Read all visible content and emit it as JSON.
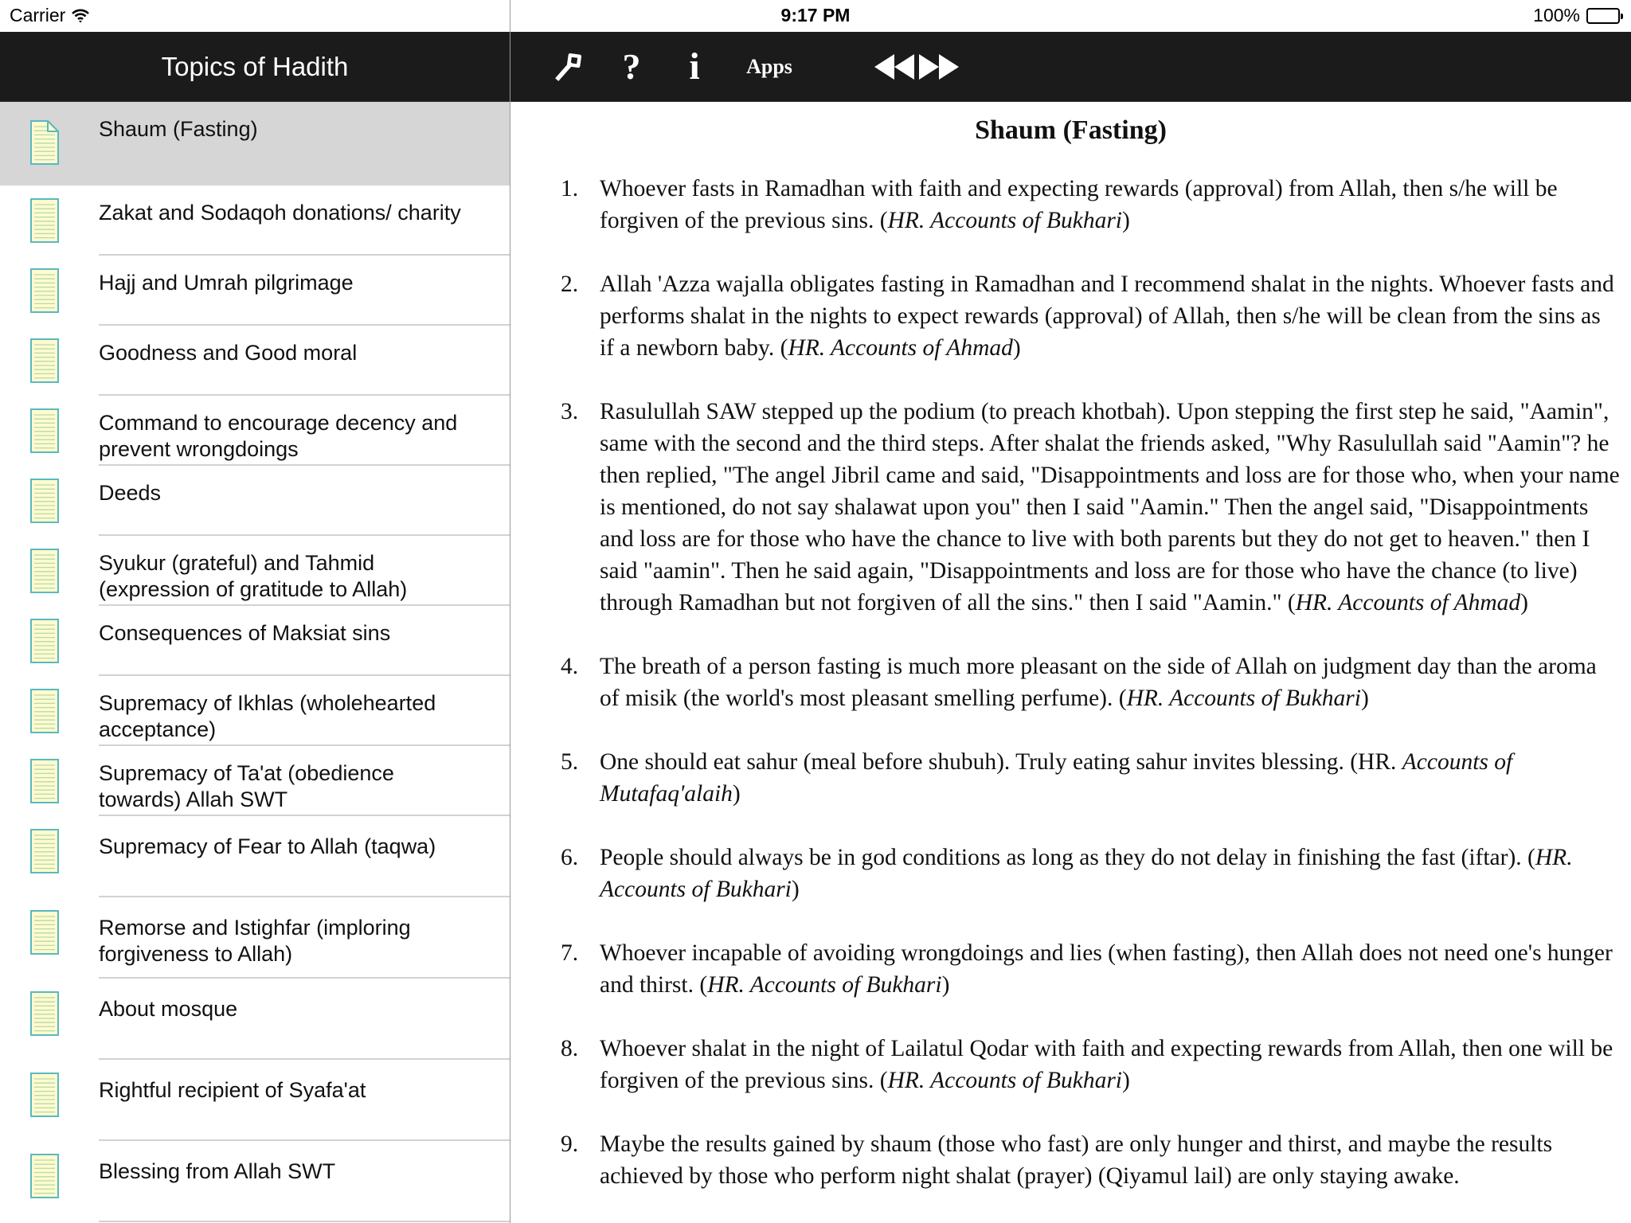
{
  "status_bar": {
    "carrier": "Carrier",
    "time": "9:17 PM",
    "battery": "100%",
    "wifi_icon": "wifi-icon",
    "battery_icon": "battery-icon"
  },
  "sidebar": {
    "title": "Topics of Hadith",
    "selected_index": 0,
    "items": [
      {
        "label": "Shaum (Fasting)"
      },
      {
        "label": "Zakat and Sodaqoh donations/ charity"
      },
      {
        "label": "Hajj and Umrah pilgrimage"
      },
      {
        "label": "Goodness and Good moral"
      },
      {
        "label": "Command to encourage decency and prevent wrongdoings"
      },
      {
        "label": "Deeds"
      },
      {
        "label": "Syukur (grateful) and Tahmid (expression of gratitude to Allah)"
      },
      {
        "label": "Consequences of Maksiat sins"
      },
      {
        "label": "Supremacy of Ikhlas (wholehearted acceptance)"
      },
      {
        "label": "Supremacy of Ta'at (obedience towards) Allah SWT"
      },
      {
        "label": "Supremacy of Fear to Allah (taqwa)"
      },
      {
        "label": "Remorse and Istighfar (imploring forgiveness to Allah)"
      },
      {
        "label": "About mosque"
      },
      {
        "label": "Rightful recipient of Syafa'at"
      },
      {
        "label": "Blessing from Allah SWT"
      }
    ]
  },
  "toolbar": {
    "settings_icon": "wrench-icon",
    "help_label": "?",
    "info_label": "i",
    "apps_label": "Apps",
    "prev_icon": "rewind-icon",
    "next_icon": "fast-forward-icon"
  },
  "content": {
    "title": "Shaum (Fasting)",
    "hadiths": [
      {
        "num": "1.",
        "text": "Whoever fasts in Ramadhan with faith and expecting rewards (approval) from Allah, then s/he will be forgiven of the previous sins. (",
        "source": "HR. Accounts of Bukhari",
        "end": ")"
      },
      {
        "num": "2.",
        "text": "Allah 'Azza wajalla obligates fasting in Ramadhan and I recommend shalat in the nights. Whoever fasts and performs shalat in the nights to expect rewards (approval) of Allah, then s/he will be clean from the sins as if a newborn baby. (",
        "source": "HR. Accounts of Ahmad",
        "end": ")"
      },
      {
        "num": "3.",
        "text": "Rasulullah SAW stepped up the podium (to preach khotbah). Upon stepping the first step he said, \"Aamin\", same with the second and the third steps. After shalat the friends asked, \"Why Rasulullah said \"Aamin\"? he then replied, \"The angel Jibril came and said, \"Disappointments and loss are for those who, when your name is mentioned, do not say shalawat upon you\" then I said \"Aamin.\" Then the angel said, \"Disappointments and loss are for those who have the chance to live with both parents but they do not get to heaven.\" then I said \"aamin\". Then he said again, \"Disappointments and loss are for those who have the chance (to live) through Ramadhan but not forgiven of all the sins.\" then I said \"Aamin.\" (",
        "source": "HR. Accounts of Ahmad",
        "end": ")"
      },
      {
        "num": "4.",
        "text": "The breath of a person fasting is much more pleasant on the side of Allah on judgment day than the aroma of misik (the world's most pleasant smelling perfume). (",
        "source": "HR. Accounts of Bukhari",
        "end": ")"
      },
      {
        "num": "5.",
        "text": "One should eat sahur (meal before shubuh). Truly eating sahur invites blessing. (HR. ",
        "source": "Accounts of Mutafaq'alaih",
        "end": ")"
      },
      {
        "num": "6.",
        "text": "People should always be in god conditions as long as they do not delay in finishing the fast (iftar). (",
        "source": "HR. Accounts of Bukhari",
        "end": ")"
      },
      {
        "num": "7.",
        "text": "Whoever incapable of avoiding wrongdoings and lies (when fasting), then Allah does not need one's hunger and thirst. (",
        "source": "HR. Accounts of Bukhari",
        "end": ")"
      },
      {
        "num": "8.",
        "text": "Whoever shalat in the night of Lailatul Qodar with faith and expecting rewards from Allah, then one will be forgiven of the previous sins. (",
        "source": "HR. Accounts of Bukhari",
        "end": ")"
      },
      {
        "num": "9.",
        "text": "Maybe the results gained by shaum (those who fast) are only hunger and thirst, and maybe the results achieved by those who perform night shalat (prayer) (Qiyamul lail) are only staying awake.",
        "source": "",
        "end": ""
      }
    ]
  },
  "colors": {
    "nav_bg": "#1b1b1b",
    "selected_row_bg": "#d6d6d6",
    "doc_icon_fill": "#fdfbd0",
    "doc_icon_border": "#5bb8bf",
    "doc_icon_lines": "#b9d9a8"
  }
}
